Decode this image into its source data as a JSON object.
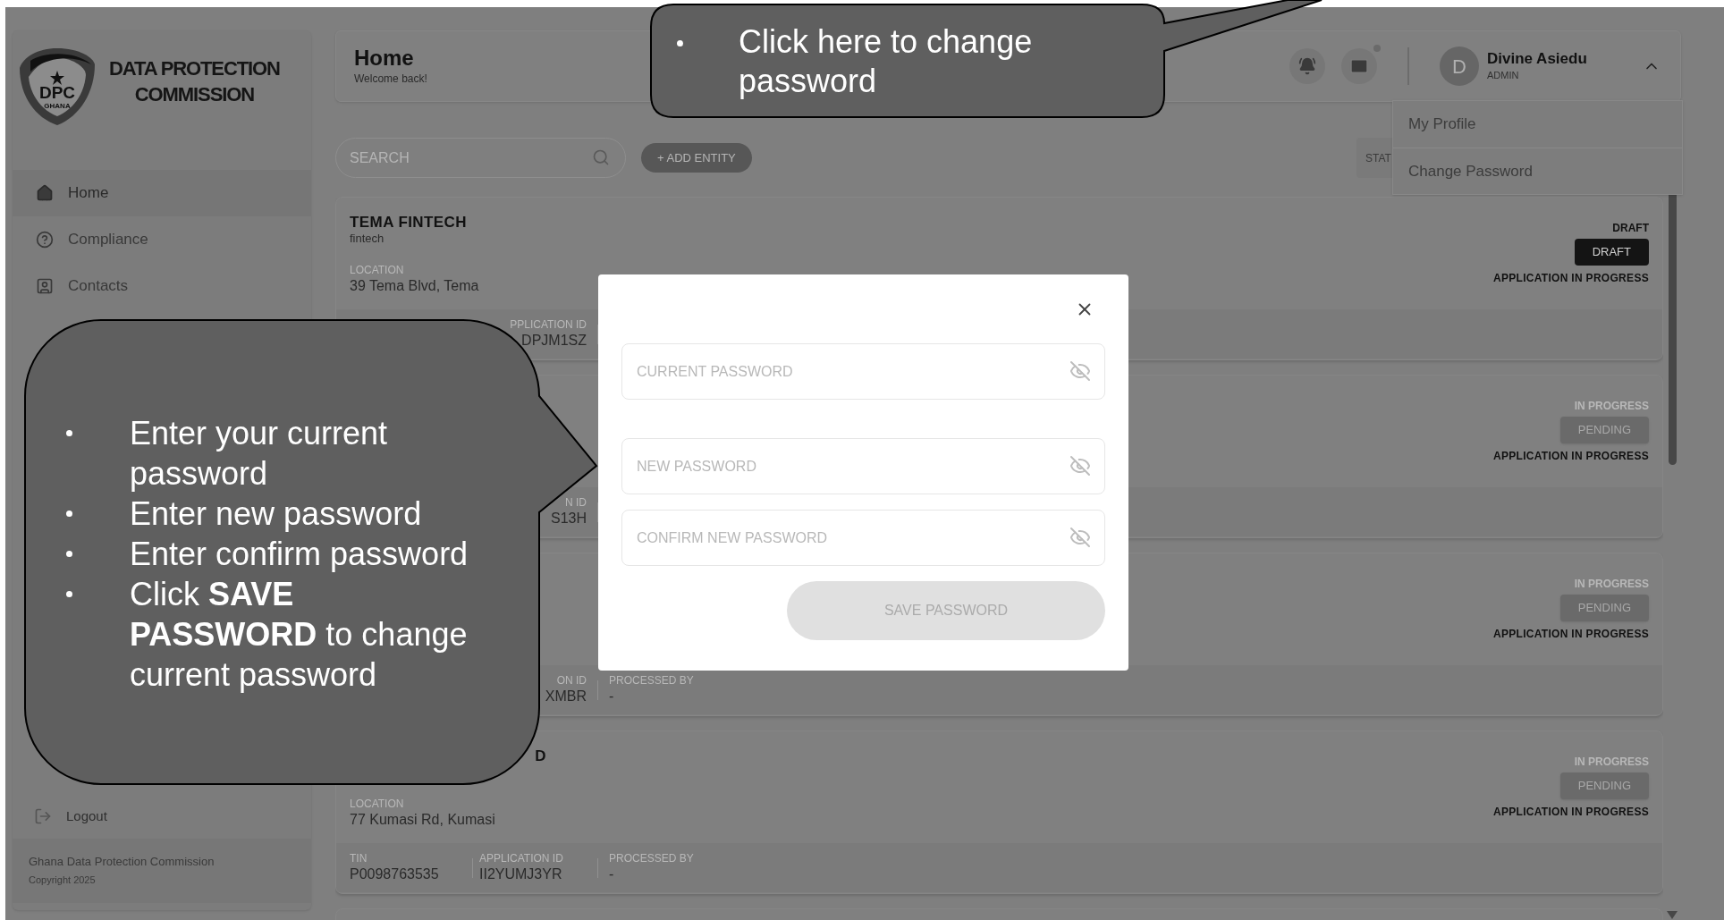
{
  "sidebar": {
    "logo": {
      "mark": "DPC",
      "country": "GHANA",
      "title_lines": [
        "DATA PROTECTION",
        "COMMISSION"
      ]
    },
    "nav": [
      {
        "label": "Home",
        "selected": true
      },
      {
        "label": "Compliance",
        "selected": false
      },
      {
        "label": "Contacts",
        "selected": false
      }
    ],
    "logout": "Logout",
    "footer": [
      "Ghana Data Protection Commission",
      "Copyright 2025"
    ]
  },
  "header": {
    "title": "Home",
    "subtitle": "Welcome back!",
    "mail_unread": true,
    "user": {
      "initial": "D",
      "name": "Divine Asiedu",
      "role": "ADMIN",
      "menu_open": true
    }
  },
  "user_menu": [
    "My Profile",
    "Change Password"
  ],
  "toolbar": {
    "search_placeholder": "SEARCH",
    "add_button": "+ ADD ENTITY",
    "status_filter": "STAT"
  },
  "entities": [
    {
      "name": "TEMA FINTECH",
      "category": "fintech",
      "location_label": "LOCATION",
      "location": "39 Tema Blvd, Tema",
      "application_id": {
        "label": "PPLICATION ID",
        "value": "DPJM1SZ"
      },
      "kind": "draft",
      "status": "DRAFT",
      "badge": "DRAFT",
      "note": "APPLICATION IN PROGRESS"
    },
    {
      "application_id": {
        "label": "N ID",
        "value": "S13H"
      },
      "kind": "pending",
      "status": "IN PROGRESS",
      "badge": "PENDING",
      "note": "APPLICATION IN PROGRESS"
    },
    {
      "application_id": {
        "label": "ON ID",
        "value": "XMBR"
      },
      "processed_by": {
        "label": "PROCESSED BY",
        "value": "-"
      },
      "kind": "pending",
      "status": "IN PROGRESS",
      "badge": "PENDING",
      "note": "APPLICATION IN PROGRESS"
    },
    {
      "name": "D",
      "name_cut": true,
      "location_label": "LOCATION",
      "location": "77 Kumasi Rd, Kumasi",
      "tin": {
        "label": "TIN",
        "value": "P0098763535"
      },
      "application_id": {
        "label": "APPLICATION ID",
        "value": "II2YUMJ3YR"
      },
      "processed_by": {
        "label": "PROCESSED BY",
        "value": "-"
      },
      "kind": "pending",
      "status": "IN PROGRESS",
      "badge": "PENDING",
      "note": "APPLICATION IN PROGRESS"
    }
  ],
  "modal": {
    "fields": [
      {
        "placeholder": "CURRENT PASSWORD"
      },
      {
        "placeholder": "NEW PASSWORD"
      },
      {
        "placeholder": "CONFIRM NEW PASSWORD"
      }
    ],
    "save_button": "SAVE PASSWORD",
    "save_disabled": true
  },
  "callouts": [
    {
      "kind": "top",
      "items": [
        "Click here to change password"
      ]
    },
    {
      "kind": "left",
      "items": [
        "Enter your current password",
        "Enter new password",
        "Enter confirm password",
        "Click **SAVE PASSWORD** to change current password"
      ]
    }
  ]
}
